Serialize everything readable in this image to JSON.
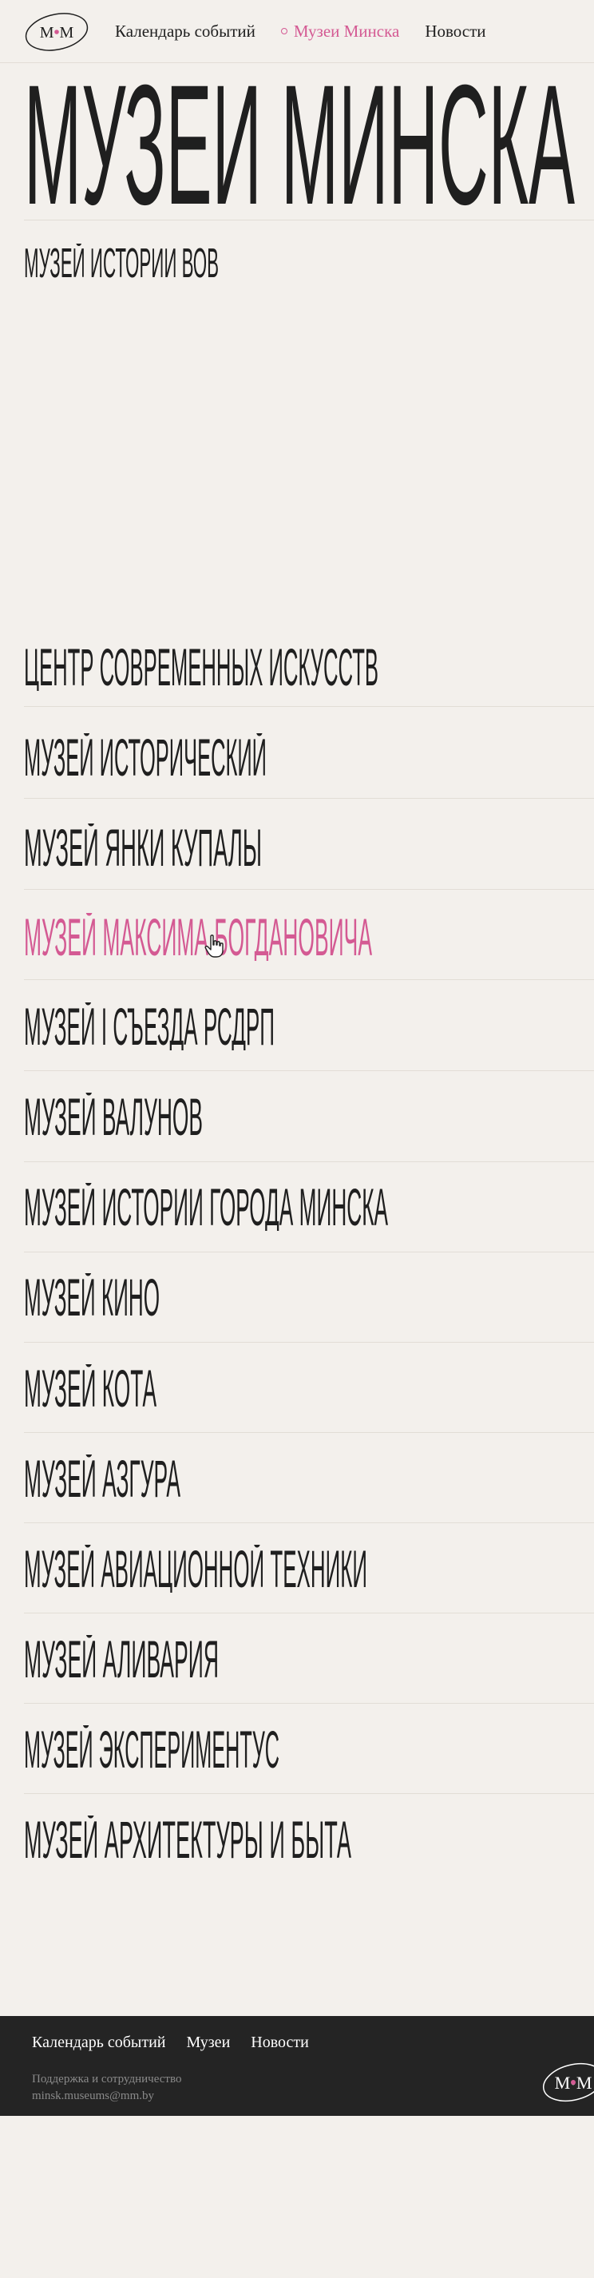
{
  "header": {
    "logo_text": "M•M",
    "nav": [
      {
        "label": "Календарь событий"
      },
      {
        "label": "Музеи Минска"
      },
      {
        "label": "Новости"
      }
    ]
  },
  "page_title": "МУЗЕИ МИНСКА",
  "museums": [
    {
      "label": "МУЗЕЙ ИСТОРИИ ВОВ"
    },
    {
      "label": "ЦЕНТР СОВРЕМЕННЫХ ИСКУССТВ"
    },
    {
      "label": "МУЗЕЙ ИСТОРИЧЕСКИЙ"
    },
    {
      "label": "МУЗЕЙ ЯНКИ КУПАЛЫ"
    },
    {
      "label": "МУЗЕЙ МАКСИМА БОГДАНОВИЧА"
    },
    {
      "label": "МУЗЕЙ I СЪЕЗДА РСДРП"
    },
    {
      "label": "МУЗЕЙ ВАЛУНОВ"
    },
    {
      "label": "МУЗЕЙ ИСТОРИИ ГОРОДА МИНСКА"
    },
    {
      "label": "МУЗЕЙ КИНО"
    },
    {
      "label": "МУЗЕЙ КОТА"
    },
    {
      "label": "МУЗЕЙ АЗГУРА"
    },
    {
      "label": "МУЗЕЙ АВИАЦИОННОЙ ТЕХНИКИ"
    },
    {
      "label": "МУЗЕЙ АЛИВАРИЯ"
    },
    {
      "label": "МУЗЕЙ ЭКСПЕРИМЕНТУС"
    },
    {
      "label": "МУЗЕЙ АРХИТЕКТУРЫ И БЫТА"
    }
  ],
  "colors": {
    "accent": "#d45a93",
    "text": "#1f1f1f",
    "background": "#f3f0ec",
    "footer": "#242424"
  },
  "footer": {
    "nav": [
      {
        "label": "Календарь событий"
      },
      {
        "label": "Музеи"
      },
      {
        "label": "Новости"
      }
    ],
    "support": "Поддержка и сотрудничество",
    "email": "minsk.museums@mm.by",
    "logo_text": "M•M"
  }
}
